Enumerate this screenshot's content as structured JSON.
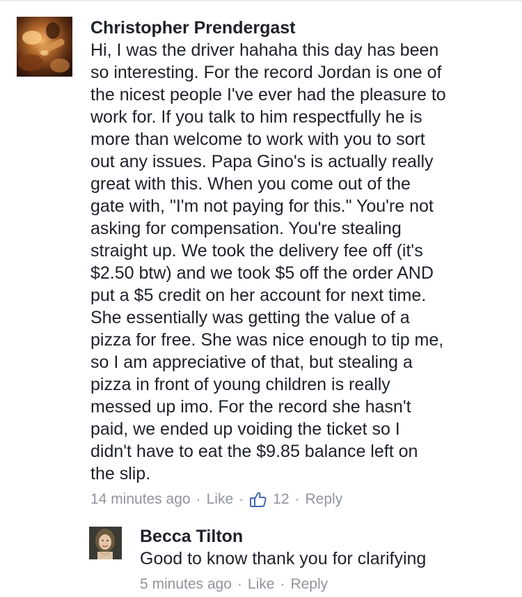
{
  "comments": [
    {
      "author": "Christopher Prendergast",
      "avatar_icon": "profile-photo-icon",
      "text_lines": [
        "Hi, I was the driver hahaha this day has been",
        "so interesting. For the record Jordan is one of",
        "the nicest people I've ever had the pleasure to",
        "work for. If you talk to him respectfully he is",
        "more than welcome to work with you to sort",
        "out any issues. Papa Gino's is actually really",
        "great with this. When you come out of the",
        "gate with, \"I'm not paying for this.\" You're not",
        "asking for compensation. You're stealing",
        "straight up. We took the delivery fee off (it's",
        "$2.50 btw) and we took $5 off the order AND",
        "put a $5 credit on her account for next time.",
        "She essentially was getting the value of a",
        "pizza for free. She was nice enough to tip me,",
        "so I am appreciative of that, but stealing a",
        "pizza in front of young children is really",
        "messed up imo. For the record she hasn't",
        "paid, we ended up voiding the ticket so I",
        "didn't have to eat the $9.85 balance left on",
        "the slip."
      ],
      "time": "14 minutes ago",
      "like_label": "Like",
      "reaction_icon": "thumbs-up-icon",
      "reaction_count": "12",
      "reply_label": "Reply",
      "separator": "·"
    },
    {
      "author": "Becca Tilton",
      "avatar_icon": "profile-photo-icon",
      "text_lines": [
        "Good to know thank you for clarifying"
      ],
      "time": "5 minutes ago",
      "like_label": "Like",
      "reply_label": "Reply",
      "separator": "·"
    }
  ],
  "colors": {
    "text": "#1d2129",
    "meta": "#90949c",
    "link_blue": "#4267b2"
  }
}
